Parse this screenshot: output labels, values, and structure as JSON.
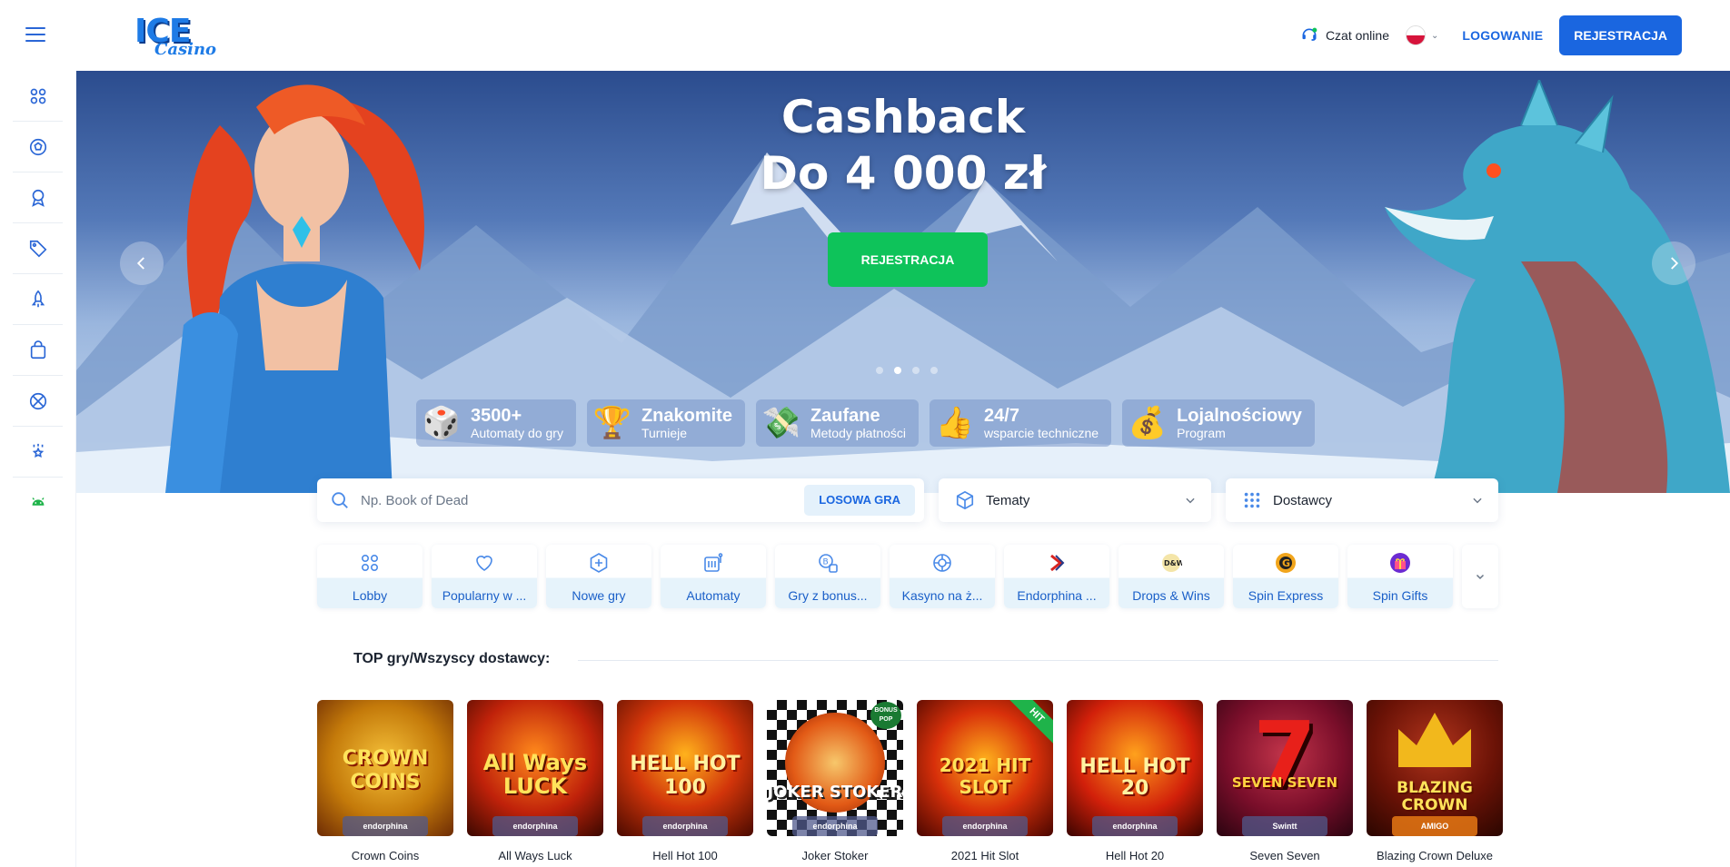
{
  "header": {
    "chat_label": "Czat online",
    "login_label": "LOGOWANIE",
    "register_label": "REJESTRACJA",
    "logo_text": "ICE",
    "logo_sub": "Casino",
    "language": "PL"
  },
  "sidebar": {
    "items": [
      {
        "icon": "grid-icon"
      },
      {
        "icon": "football-icon"
      },
      {
        "icon": "award-icon"
      },
      {
        "icon": "tag-icon"
      },
      {
        "icon": "rocket-icon"
      },
      {
        "icon": "shopping-bag-icon"
      },
      {
        "icon": "basketball-icon"
      },
      {
        "icon": "trophy-star-icon"
      },
      {
        "icon": "android-icon"
      }
    ]
  },
  "hero": {
    "title_line1": "Cashback",
    "title_line2": "Do 4 000 zł",
    "cta_label": "REJESTRACJA",
    "slide_count": 4,
    "active_slide": 2,
    "features": [
      {
        "title": "3500+",
        "subtitle": "Automaty do gry",
        "icon": "dice-icon"
      },
      {
        "title": "Znakomite",
        "subtitle": "Turnieje",
        "icon": "trophy-icon"
      },
      {
        "title": "Zaufane",
        "subtitle": "Metody płatności",
        "icon": "money-icon"
      },
      {
        "title": "24/7",
        "subtitle": "wsparcie techniczne",
        "icon": "thumbs-up-icon"
      },
      {
        "title": "Lojalnościowy",
        "subtitle": "Program",
        "icon": "money-bag-icon"
      }
    ]
  },
  "search": {
    "placeholder": "Np. Book of Dead",
    "random_label": "LOSOWA GRA",
    "themes_label": "Tematy",
    "providers_label": "Dostawcy"
  },
  "categories": [
    {
      "label": "Lobby",
      "icon": "lobby-icon"
    },
    {
      "label": "Popularny w ...",
      "icon": "heart-icon"
    },
    {
      "label": "Nowe gry",
      "icon": "new-icon"
    },
    {
      "label": "Automaty",
      "icon": "slot-machine-icon"
    },
    {
      "label": "Gry z bonus...",
      "icon": "bonus-icon"
    },
    {
      "label": "Kasyno na ż...",
      "icon": "live-casino-icon"
    },
    {
      "label": "Endorphina ...",
      "icon": "endorphina-icon"
    },
    {
      "label": "Drops & Wins",
      "icon": "drops-wins-icon"
    },
    {
      "label": "Spin Express",
      "icon": "spin-express-icon"
    },
    {
      "label": "Spin Gifts",
      "icon": "spin-gifts-icon"
    }
  ],
  "section": {
    "title": "TOP gry/Wszyscy dostawcy:"
  },
  "games": [
    {
      "title": "Crown Coins",
      "art": "CROWN COINS",
      "provider": "endorphina"
    },
    {
      "title": "All Ways Luck",
      "art": "All Ways LUCK",
      "provider": "endorphina"
    },
    {
      "title": "Hell Hot 100",
      "art": "HELL HOT 100",
      "provider": "endorphina"
    },
    {
      "title": "Joker Stoker",
      "art": "JOKER STOKER",
      "provider": "endorphina",
      "badge": "BONUS POP"
    },
    {
      "title": "2021 Hit Slot",
      "art": "2021 HIT SLOT",
      "provider": "endorphina",
      "badge": "HIT"
    },
    {
      "title": "Hell Hot 20",
      "art": "HELL HOT 20",
      "provider": "endorphina"
    },
    {
      "title": "Seven Seven",
      "art": "SEVEN SEVEN",
      "provider": "Swintt"
    },
    {
      "title": "Blazing Crown Deluxe",
      "art": "BLAZING CROWN",
      "provider": "AMIGO"
    }
  ],
  "colors": {
    "primary": "#1a66e0",
    "cta_green": "#0ec35a",
    "hit_green": "#1fb34a"
  }
}
